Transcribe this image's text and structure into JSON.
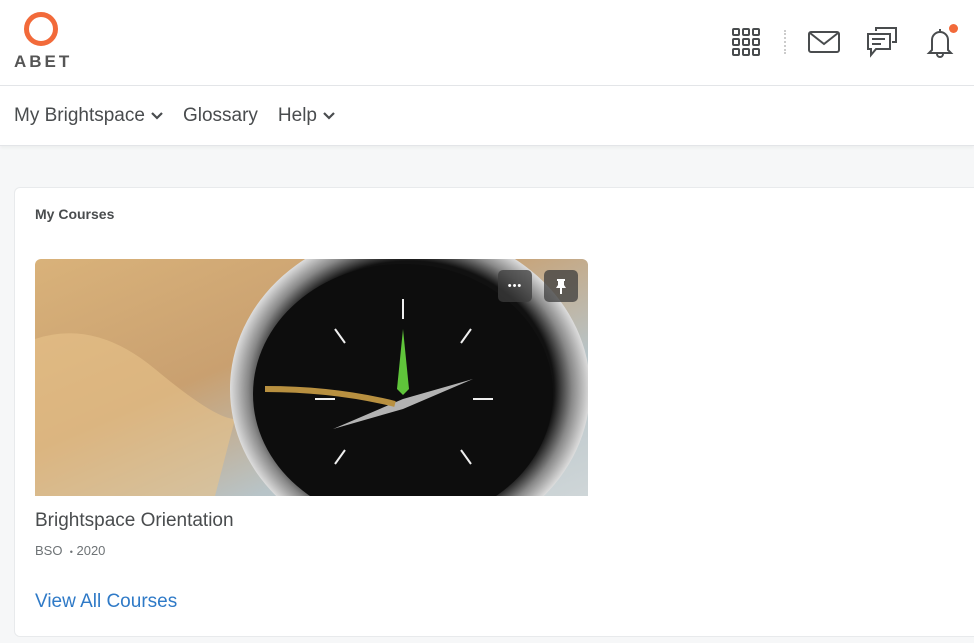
{
  "header": {
    "logo_text": "ABET",
    "icons": [
      "apps-grid-icon",
      "mail-icon",
      "chat-icon",
      "bell-icon"
    ],
    "notification_dot": true,
    "accent": "#f26a3a"
  },
  "nav": {
    "items": [
      {
        "label": "My Brightspace",
        "dropdown": true
      },
      {
        "label": "Glossary",
        "dropdown": false
      },
      {
        "label": "Help",
        "dropdown": true
      }
    ]
  },
  "widget": {
    "title": "My Courses",
    "course": {
      "name": "Brightspace Orientation",
      "code": "BSO",
      "separator": "•",
      "year": "2020",
      "image": "compass-on-map"
    },
    "more_label": "•••",
    "view_all": "View All Courses",
    "link_color": "#2f7ac7"
  }
}
